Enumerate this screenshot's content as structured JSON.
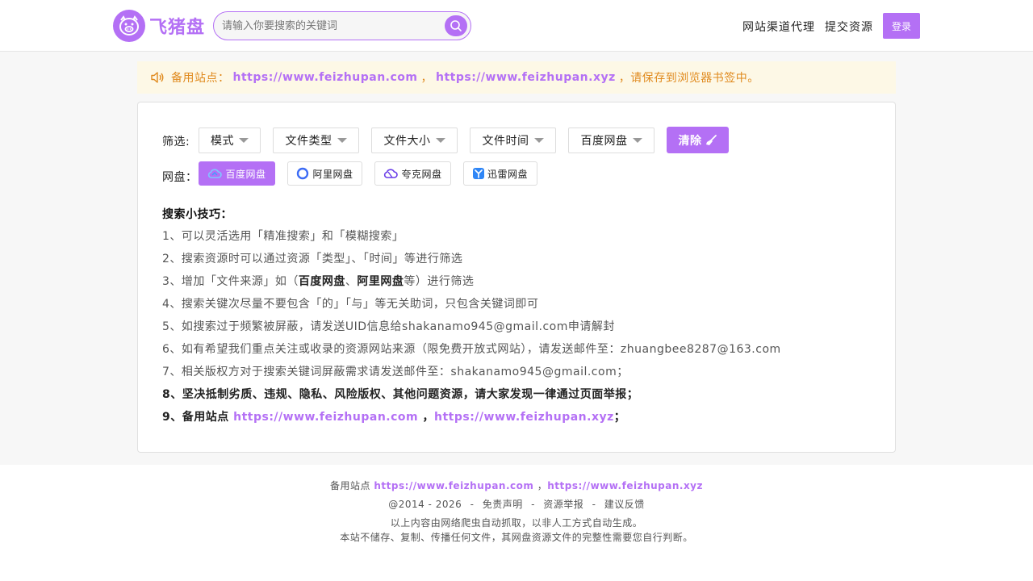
{
  "brand": {
    "name": "飞猪盘",
    "color": "#b470f5"
  },
  "search": {
    "placeholder": "请输入你要搜索的关键词"
  },
  "nav": {
    "agent": "网站渠道代理",
    "submit": "提交资源",
    "login": "登录"
  },
  "notice": {
    "prefix": "备用站点：",
    "link1": "https://www.feizhupan.com",
    "sep": "，",
    "link2": "https://www.feizhupan.xyz",
    "suffix": "，请保存到浏览器书签中。"
  },
  "filters": {
    "label": "筛选:",
    "dropdowns": [
      "模式",
      "文件类型",
      "文件大小",
      "文件时间",
      "百度网盘"
    ],
    "clear": "清除"
  },
  "disks": {
    "label": "网盘：",
    "items": [
      "百度网盘",
      "阿里网盘",
      "夸克网盘",
      "迅雷网盘"
    ]
  },
  "tips": {
    "title": "搜索小技巧：",
    "t1": "1、可以灵活选用「精准搜索」和「模糊搜索」",
    "t2": "2、搜索资源时可以通过资源「类型」、「时间」等进行筛选",
    "t3_pre": "3、增加「文件来源」如（",
    "t3_b1": "百度网盘",
    "t3_mid": "、",
    "t3_b2": "阿里网盘",
    "t3_post": "等）进行筛选",
    "t4": "4、搜索关键次尽量不要包含「的」「与」等无关助词，只包含关键词即可",
    "t5": "5、如搜索过于频繁被屏蔽，请发送UID信息给shakanamo945@gmail.com申请解封",
    "t6": "6、如有希望我们重点关注或收录的资源网站来源（限免费开放式网站），请发送邮件至：zhuangbee8287@163.com",
    "t7": "7、相关版权方对于搜索关键词屏蔽需求请发送邮件至：shakanamo945@gmail.com；",
    "t8": "8、坚决抵制劣质、违规、隐私、风险版权、其他问题资源，请大家发现一律通过页面举报；",
    "t9_pre": "9、备用站点",
    "t9_link1": "https://www.feizhupan.com",
    "t9_sep": "，",
    "t9_link2": "https://www.feizhupan.xyz",
    "t9_post": "；"
  },
  "footer": {
    "backup_label": "备用站点",
    "link1": "https://www.feizhupan.com",
    "sep": "，",
    "link2": "https://www.feizhupan.xyz",
    "copyright": "@2014 - 2026",
    "disclaimer": "免责声明",
    "report": "资源举报",
    "feedback": "建议反馈",
    "dash": "-",
    "line3": "以上内容由网络爬虫自动抓取，以非人工方式自动生成。",
    "line4": "本站不储存、复制、传播任何文件，其网盘资源文件的完整性需要您自行判断。"
  }
}
